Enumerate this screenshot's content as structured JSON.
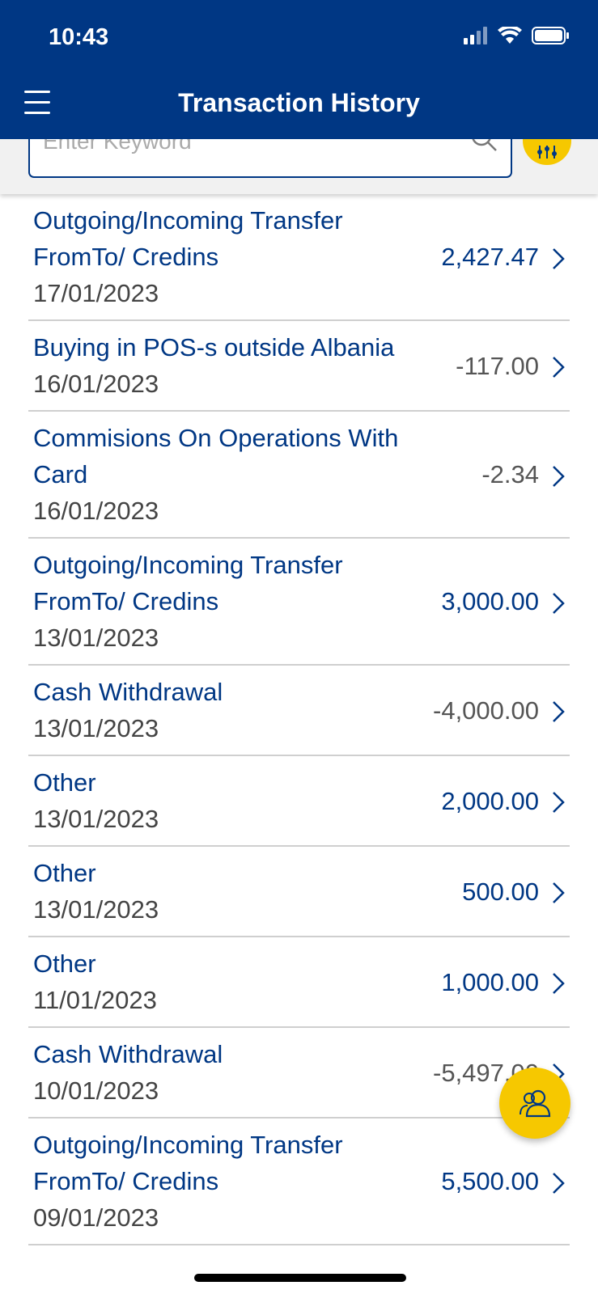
{
  "status": {
    "time": "10:43"
  },
  "header": {
    "title": "Transaction History"
  },
  "search": {
    "placeholder": "Enter Keyword"
  },
  "transactions": [
    {
      "description": "Outgoing/Incoming Transfer FromTo/ Credins",
      "date": "17/01/2023",
      "amount": "2,427.47",
      "sign": "pos"
    },
    {
      "description": "Buying in POS-s outside Albania",
      "date": "16/01/2023",
      "amount": "-117.00",
      "sign": "neg"
    },
    {
      "description": "Commisions On Operations With Card",
      "date": "16/01/2023",
      "amount": "-2.34",
      "sign": "neg"
    },
    {
      "description": "Outgoing/Incoming Transfer FromTo/ Credins",
      "date": "13/01/2023",
      "amount": "3,000.00",
      "sign": "pos"
    },
    {
      "description": "Cash Withdrawal",
      "date": "13/01/2023",
      "amount": "-4,000.00",
      "sign": "neg"
    },
    {
      "description": "Other",
      "date": "13/01/2023",
      "amount": "2,000.00",
      "sign": "pos"
    },
    {
      "description": "Other",
      "date": "13/01/2023",
      "amount": "500.00",
      "sign": "pos"
    },
    {
      "description": "Other",
      "date": "11/01/2023",
      "amount": "1,000.00",
      "sign": "pos"
    },
    {
      "description": "Cash Withdrawal",
      "date": "10/01/2023",
      "amount": "-5,497.00",
      "sign": "neg"
    },
    {
      "description": "Outgoing/Incoming Transfer FromTo/ Credins",
      "date": "09/01/2023",
      "amount": "5,500.00",
      "sign": "pos"
    }
  ],
  "icons": {
    "menu": "hamburger-icon",
    "search": "search-icon",
    "filter": "filter-icon",
    "fab": "people-icon",
    "row": "chevron-right-icon"
  },
  "colors": {
    "brand": "#003784",
    "accent": "#f6c800"
  }
}
